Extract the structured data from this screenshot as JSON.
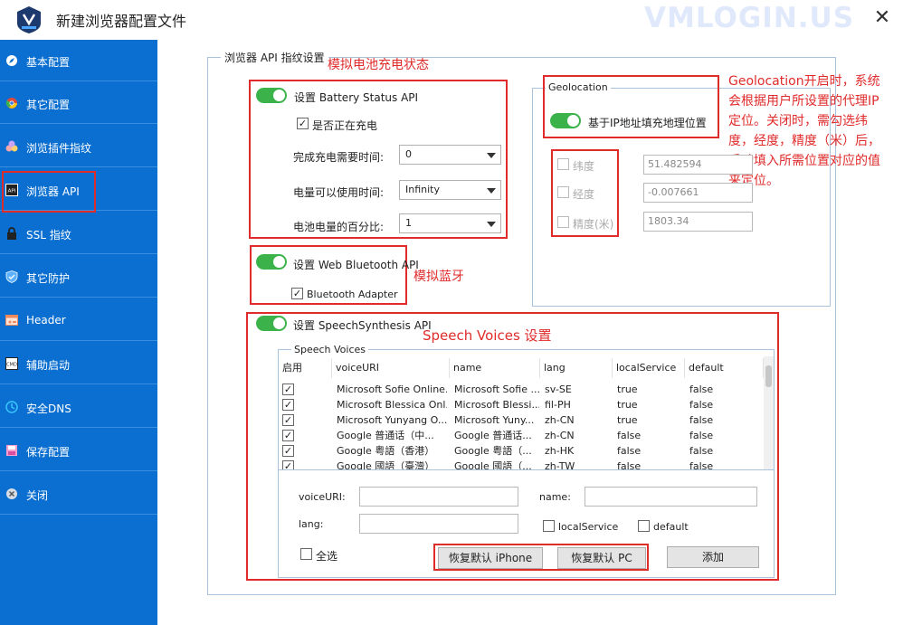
{
  "window": {
    "title": "新建浏览器配置文件",
    "watermark": "VMLOGIN.US",
    "close_icon": "✕"
  },
  "sidebar": {
    "items": [
      {
        "label": "基本配置",
        "icon": "compass-icon"
      },
      {
        "label": "其它配置",
        "icon": "chrome-icon"
      },
      {
        "label": "浏览插件指纹",
        "icon": "plugin-icon"
      },
      {
        "label": "浏览器 API",
        "icon": "api-icon"
      },
      {
        "label": "SSL 指纹",
        "icon": "lock-icon"
      },
      {
        "label": "其它防护",
        "icon": "shield-icon"
      },
      {
        "label": "Header",
        "icon": "header-icon"
      },
      {
        "label": "辅助启动",
        "icon": "cmd-icon"
      },
      {
        "label": "安全DNS",
        "icon": "dns-icon"
      },
      {
        "label": "保存配置",
        "icon": "save-icon"
      },
      {
        "label": "关闭",
        "icon": "close-circle-icon"
      }
    ],
    "active_index": 3
  },
  "main": {
    "group_title": "浏览器 API 指纹设置",
    "battery": {
      "annotation": "模拟电池充电状态",
      "toggle_label": "设置 Battery Status API",
      "charging_label": "是否正在充电",
      "charging_checked": true,
      "charge_time_label": "完成充电需要时间:",
      "charge_time_value": "0",
      "discharge_time_label": "电量可以使用时间:",
      "discharge_time_value": "Infinity",
      "level_label": "电池电量的百分比:",
      "level_value": "1"
    },
    "bluetooth": {
      "annotation": "模拟蓝牙",
      "toggle_label": "设置 Web Bluetooth API",
      "adapter_label": "Bluetooth Adapter",
      "adapter_checked": true
    },
    "geolocation": {
      "group_title": "Geolocation",
      "toggle_label": "基于IP地址填充地理位置",
      "annotation": "Geolocation开启时，系统会根据用户所设置的代理IP定位。关闭时，需勾选纬度，经度，精度（米）后，手动填入所需位置对应的值来定位。",
      "annotation_lines": [
        "Geolocation开启时，系统",
        "会根据用户所设置的代理IP",
        "定位。关闭时，需勾选纬",
        "度，经度，精度（米）后，",
        "手动填入所需位置对应的值",
        "来定位。"
      ],
      "latitude_label": "纬度",
      "latitude_value": "51.482594",
      "longitude_label": "经度",
      "longitude_value": "-0.007661",
      "accuracy_label": "精度(米)",
      "accuracy_value": "1803.34"
    },
    "speech": {
      "toggle_label": "设置 SpeechSynthesis API",
      "annotation": "Speech Voices 设置",
      "group_title": "Speech Voices",
      "columns": [
        "启用",
        "voiceURI",
        "name",
        "lang",
        "localService",
        "default"
      ],
      "rows": [
        {
          "enabled": true,
          "voiceURI": "Microsoft Sofie Online...",
          "name": "Microsoft Sofie ...",
          "lang": "sv-SE",
          "localService": "true",
          "default": "false"
        },
        {
          "enabled": true,
          "voiceURI": "Microsoft Blessica Onl...",
          "name": "Microsoft Blessi...",
          "lang": "fil-PH",
          "localService": "true",
          "default": "false"
        },
        {
          "enabled": true,
          "voiceURI": "Microsoft Yunyang O...",
          "name": "Microsoft Yuny...",
          "lang": "zh-CN",
          "localService": "true",
          "default": "false"
        },
        {
          "enabled": true,
          "voiceURI": "Google 普通话（中...",
          "name": "Google 普通话...",
          "lang": "zh-CN",
          "localService": "false",
          "default": "false"
        },
        {
          "enabled": true,
          "voiceURI": "Google 粤語（香港）",
          "name": "Google 粤語（...",
          "lang": "zh-HK",
          "localService": "false",
          "default": "false"
        },
        {
          "enabled": true,
          "voiceURI": "Google 國語（臺灣）",
          "name": "Google 國語（...",
          "lang": "zh-TW",
          "localService": "false",
          "default": "false"
        }
      ],
      "form": {
        "voiceuri_label": "voiceURI:",
        "name_label": "name:",
        "lang_label": "lang:",
        "local_service_label": "localService",
        "default_label": "default",
        "select_all_label": "全选",
        "restore_iphone_label": "恢复默认 iPhone",
        "restore_pc_label": "恢复默认 PC",
        "add_label": "添加"
      }
    }
  }
}
